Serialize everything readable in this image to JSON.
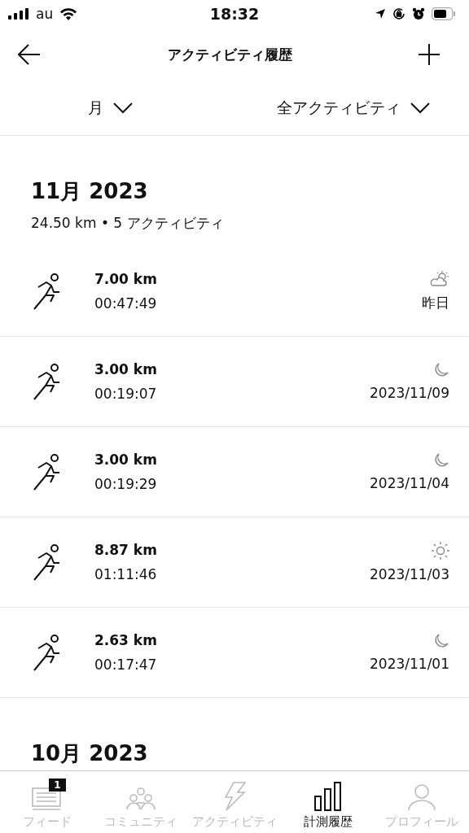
{
  "status_bar": {
    "carrier": "au",
    "time": "18:32"
  },
  "nav": {
    "title": "アクティビティ履歴"
  },
  "filters": [
    {
      "label": "月"
    },
    {
      "label": "全アクティビティ"
    }
  ],
  "months": [
    {
      "title": "11月 2023",
      "summary": "24.50 km • 5 アクティビティ",
      "activities": [
        {
          "distance": "7.00 km",
          "duration": "00:47:49",
          "kind": "cloudy",
          "date": "昨日"
        },
        {
          "distance": "3.00 km",
          "duration": "00:19:07",
          "kind": "night",
          "date": "2023/11/09"
        },
        {
          "distance": "3.00 km",
          "duration": "00:19:29",
          "kind": "night",
          "date": "2023/11/04"
        },
        {
          "distance": "8.87 km",
          "duration": "01:11:46",
          "kind": "sunny",
          "date": "2023/11/03"
        },
        {
          "distance": "2.63 km",
          "duration": "00:17:47",
          "kind": "night",
          "date": "2023/11/01"
        }
      ]
    },
    {
      "title": "10月 2023"
    }
  ],
  "tab_bar": [
    {
      "label": "フィード",
      "badge": "1",
      "selected": false
    },
    {
      "label": "コミュニティ",
      "selected": false
    },
    {
      "label": "アクティビティ",
      "selected": false
    },
    {
      "label": "計測履歴",
      "selected": true
    },
    {
      "label": "プロフィール",
      "selected": false
    }
  ]
}
